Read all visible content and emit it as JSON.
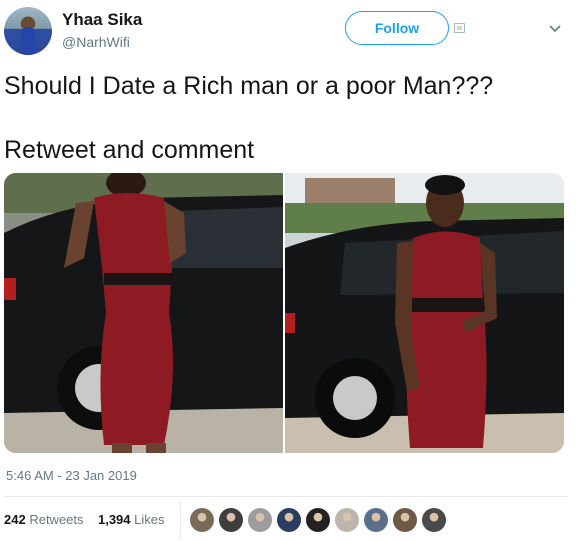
{
  "user": {
    "display_name": "Yhaa Sika",
    "handle": "@NarhWifi"
  },
  "follow": {
    "label": "Follow"
  },
  "tweet": {
    "line1": "Should I Date a Rich man or a poor Man???",
    "line2": "Retweet and comment"
  },
  "meta": {
    "timestamp": "5:46 AM - 23 Jan 2019"
  },
  "stats": {
    "retweets_count": "242",
    "retweets_label": "Retweets",
    "likes_count": "1,394",
    "likes_label": "Likes"
  },
  "colors": {
    "accent": "#1da1f2",
    "muted": "#657786",
    "text": "#14171a"
  },
  "likers": [
    {
      "icon": "liker-avatar-1",
      "color": "#7b6a5a"
    },
    {
      "icon": "liker-avatar-2",
      "color": "#3e3e3e"
    },
    {
      "icon": "liker-avatar-3",
      "color": "#9d9d9d"
    },
    {
      "icon": "liker-avatar-4",
      "color": "#2c3e60"
    },
    {
      "icon": "liker-avatar-5",
      "color": "#222222"
    },
    {
      "icon": "liker-avatar-6",
      "color": "#bdb6ad"
    },
    {
      "icon": "liker-avatar-7",
      "color": "#5a6f8a"
    },
    {
      "icon": "liker-avatar-8",
      "color": "#6e5846"
    },
    {
      "icon": "liker-avatar-9",
      "color": "#4a4a4a"
    }
  ]
}
